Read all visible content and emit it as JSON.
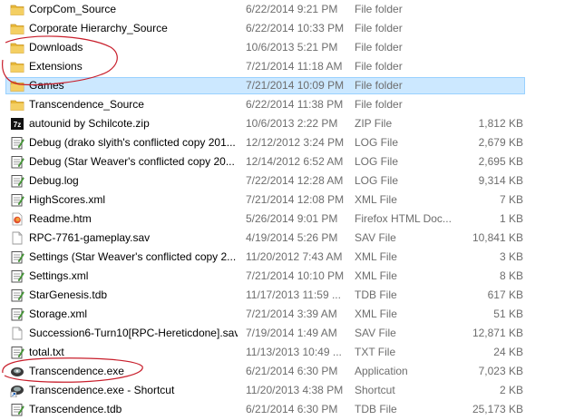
{
  "files": [
    {
      "icon": "folder-icon",
      "name": "CorpCom_Source",
      "date": "6/22/2014 9:21 PM",
      "type": "File folder",
      "size": ""
    },
    {
      "icon": "folder-icon",
      "name": "Corporate Hierarchy_Source",
      "date": "6/22/2014 10:33 PM",
      "type": "File folder",
      "size": ""
    },
    {
      "icon": "folder-icon",
      "name": "Downloads",
      "date": "10/6/2013 5:21 PM",
      "type": "File folder",
      "size": ""
    },
    {
      "icon": "folder-icon",
      "name": "Extensions",
      "date": "7/21/2014 11:18 AM",
      "type": "File folder",
      "size": ""
    },
    {
      "icon": "folder-icon",
      "name": "Games",
      "date": "7/21/2014 10:09 PM",
      "type": "File folder",
      "size": "",
      "selected": true
    },
    {
      "icon": "folder-icon",
      "name": "Transcendence_Source",
      "date": "6/22/2014 11:38 PM",
      "type": "File folder",
      "size": ""
    },
    {
      "icon": "zip-7z-icon",
      "name": "autounid by Schilcote.zip",
      "date": "10/6/2013 2:22 PM",
      "type": "ZIP File",
      "size": "1,812 KB"
    },
    {
      "icon": "notepad-icon",
      "name": "Debug (drako slyith's conflicted copy 201...",
      "date": "12/12/2012 3:24 PM",
      "type": "LOG File",
      "size": "2,679 KB"
    },
    {
      "icon": "notepad-icon",
      "name": "Debug (Star Weaver's conflicted copy 20...",
      "date": "12/14/2012 6:52 AM",
      "type": "LOG File",
      "size": "2,695 KB"
    },
    {
      "icon": "notepad-icon",
      "name": "Debug.log",
      "date": "7/22/2014 12:28 AM",
      "type": "LOG File",
      "size": "9,314 KB"
    },
    {
      "icon": "notepad-icon",
      "name": "HighScores.xml",
      "date": "7/21/2014 12:08 PM",
      "type": "XML File",
      "size": "7 KB"
    },
    {
      "icon": "firefox-html-icon",
      "name": "Readme.htm",
      "date": "5/26/2014 9:01 PM",
      "type": "Firefox HTML Doc...",
      "size": "1 KB"
    },
    {
      "icon": "blank-file-icon",
      "name": "RPC-7761-gameplay.sav",
      "date": "4/19/2014 5:26 PM",
      "type": "SAV File",
      "size": "10,841 KB"
    },
    {
      "icon": "notepad-icon",
      "name": "Settings (Star Weaver's conflicted copy 2...",
      "date": "11/20/2012 7:43 AM",
      "type": "XML File",
      "size": "3 KB"
    },
    {
      "icon": "notepad-icon",
      "name": "Settings.xml",
      "date": "7/21/2014 10:10 PM",
      "type": "XML File",
      "size": "8 KB"
    },
    {
      "icon": "notepad-icon",
      "name": "StarGenesis.tdb",
      "date": "11/17/2013 11:59 ...",
      "type": "TDB File",
      "size": "617 KB"
    },
    {
      "icon": "notepad-icon",
      "name": "Storage.xml",
      "date": "7/21/2014 3:39 AM",
      "type": "XML File",
      "size": "51 KB"
    },
    {
      "icon": "blank-file-icon",
      "name": "Succession6-Turn10[RPC-Hereticdone].sav",
      "date": "7/19/2014 1:49 AM",
      "type": "SAV File",
      "size": "12,871 KB"
    },
    {
      "icon": "notepad-icon",
      "name": "total.txt",
      "date": "11/13/2013 10:49 ...",
      "type": "TXT File",
      "size": "24 KB"
    },
    {
      "icon": "transcendence-app-icon",
      "name": "Transcendence.exe",
      "date": "6/21/2014 6:30 PM",
      "type": "Application",
      "size": "7,023 KB"
    },
    {
      "icon": "transcendence-shortcut-icon",
      "name": "Transcendence.exe - Shortcut",
      "date": "11/20/2013 4:38 PM",
      "type": "Shortcut",
      "size": "2 KB"
    },
    {
      "icon": "notepad-icon",
      "name": "Transcendence.tdb",
      "date": "6/21/2014 6:30 PM",
      "type": "TDB File",
      "size": "25,173 KB"
    }
  ],
  "colors": {
    "selection_fill": "#cce8ff",
    "selection_border": "#99d1ff",
    "folder": "#e8b93a",
    "annotation": "#c81e2b",
    "secondary_text": "#6d6d6d"
  }
}
